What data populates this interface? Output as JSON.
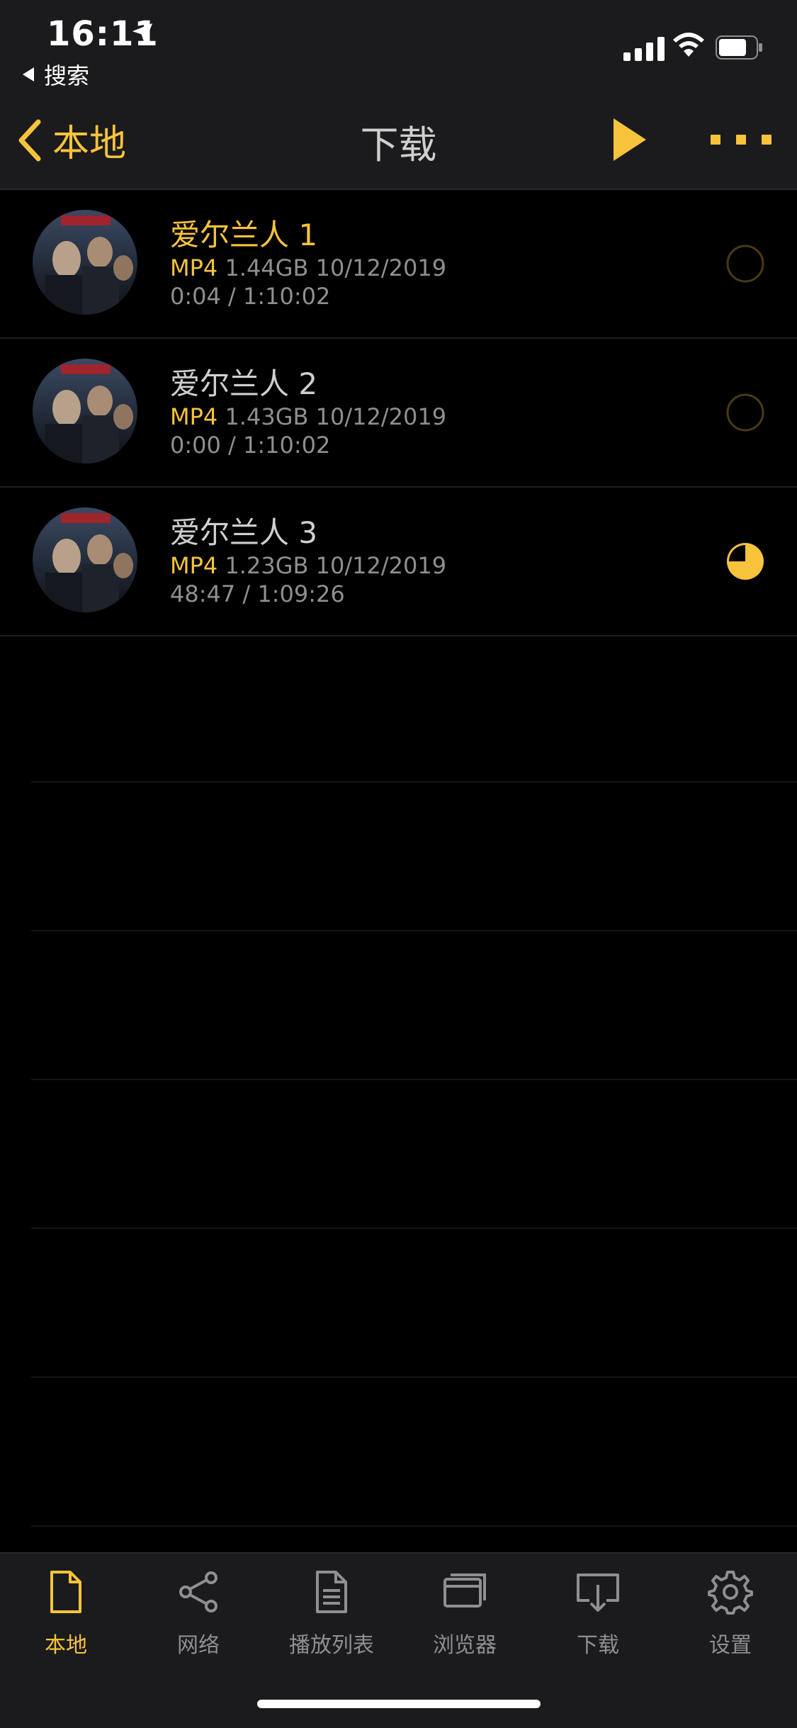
{
  "status": {
    "time": "16:11",
    "back_app": "搜索"
  },
  "nav": {
    "back_label": "本地",
    "title": "下载"
  },
  "colors": {
    "accent": "#f6c33b",
    "bg": "#000000",
    "bar": "#1b1b1d",
    "text_dim": "#8f8f92"
  },
  "items": [
    {
      "title": "爱尔兰人 1",
      "format": "MP4",
      "size_date": "1.44GB 10/12/2019",
      "progress": "0:04 / 1:10:02",
      "active": true,
      "download_fraction": 0.0
    },
    {
      "title": "爱尔兰人 2",
      "format": "MP4",
      "size_date": "1.43GB 10/12/2019",
      "progress": "0:00 / 1:10:02",
      "active": false,
      "download_fraction": 0.0
    },
    {
      "title": "爱尔兰人 3",
      "format": "MP4",
      "size_date": "1.23GB 10/12/2019",
      "progress": "48:47 / 1:09:26",
      "active": false,
      "download_fraction": 0.75
    }
  ],
  "tabs": [
    {
      "label": "本地",
      "icon": "document-icon",
      "active": true
    },
    {
      "label": "网络",
      "icon": "share-icon",
      "active": false
    },
    {
      "label": "播放列表",
      "icon": "playlist-icon",
      "active": false
    },
    {
      "label": "浏览器",
      "icon": "browser-icon",
      "active": false
    },
    {
      "label": "下载",
      "icon": "download-icon",
      "active": false
    },
    {
      "label": "设置",
      "icon": "gear-icon",
      "active": false
    }
  ]
}
